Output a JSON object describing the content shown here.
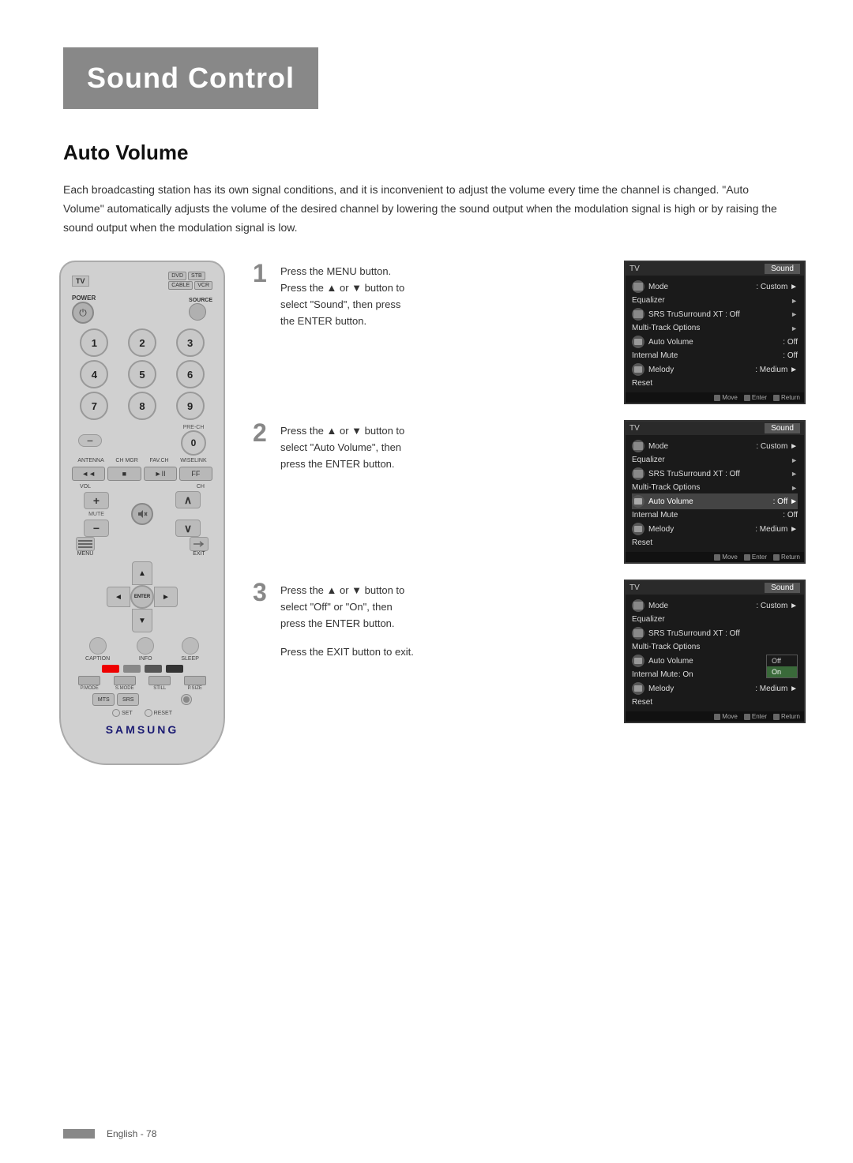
{
  "page": {
    "title": "Sound Control",
    "section": "Auto Volume",
    "description": "Each broadcasting station has its own signal conditions, and it is inconvenient to adjust the volume every time the channel is changed. \"Auto Volume\" automatically adjusts the volume of the desired channel by lowering the sound output when the modulation signal is high or by raising the sound output when the modulation signal is low.",
    "footer_text": "English - 78"
  },
  "steps": [
    {
      "number": "1",
      "instruction": "Press the MENU button.\nPress the ▲ or ▼ button to select \"Sound\", then press\nthe ENTER button."
    },
    {
      "number": "2",
      "instruction": "Press the ▲ or ▼ button to\nselect \"Auto Volume\", then\npress the ENTER button."
    },
    {
      "number": "3",
      "instruction": "Press the ▲ or ▼ button to\nselect \"Off\" or \"On\", then\npress the ENTER button.",
      "extra": "Press the EXIT button to exit."
    }
  ],
  "tv_screens": [
    {
      "header_left": "TV",
      "header_right": "Sound",
      "menu_items": [
        {
          "icon": "input",
          "label": "Mode",
          "value": ": Custom",
          "arrow": "►",
          "highlighted": false
        },
        {
          "icon": "",
          "label": "Equalizer",
          "value": "",
          "arrow": "►",
          "highlighted": false
        },
        {
          "icon": "picture",
          "label": "SRS TruSurround XT : Off",
          "value": "",
          "arrow": "►",
          "highlighted": false
        },
        {
          "icon": "",
          "label": "Multi-Track Options",
          "value": "",
          "arrow": "►",
          "highlighted": false
        },
        {
          "icon": "sound",
          "label": "Auto Volume",
          "value": ": Off",
          "arrow": "",
          "highlighted": false
        },
        {
          "icon": "",
          "label": "Internal Mute",
          "value": ": Off",
          "arrow": "",
          "highlighted": false
        },
        {
          "icon": "channel",
          "label": "Melody",
          "value": ": Medium",
          "arrow": "►",
          "highlighted": false
        },
        {
          "icon": "",
          "label": "Reset",
          "value": "",
          "arrow": "",
          "highlighted": false
        }
      ]
    },
    {
      "header_left": "TV",
      "header_right": "Sound",
      "menu_items": [
        {
          "icon": "input",
          "label": "Mode",
          "value": ": Custom",
          "arrow": "►",
          "highlighted": false
        },
        {
          "icon": "",
          "label": "Equalizer",
          "value": "",
          "arrow": "►",
          "highlighted": false
        },
        {
          "icon": "picture",
          "label": "SRS TruSurround XT : Off",
          "value": "",
          "arrow": "►",
          "highlighted": false
        },
        {
          "icon": "",
          "label": "Multi-Track Options",
          "value": "",
          "arrow": "►",
          "highlighted": false
        },
        {
          "icon": "sound",
          "label": "Auto Volume",
          "value": ": Off",
          "arrow": "►",
          "highlighted": true
        },
        {
          "icon": "",
          "label": "Internal Mute",
          "value": ": Off",
          "arrow": "",
          "highlighted": false
        },
        {
          "icon": "channel",
          "label": "Melody",
          "value": ": Medium",
          "arrow": "►",
          "highlighted": false
        },
        {
          "icon": "",
          "label": "Reset",
          "value": "",
          "arrow": "",
          "highlighted": false
        }
      ]
    },
    {
      "header_left": "TV",
      "header_right": "Sound",
      "menu_items": [
        {
          "icon": "input",
          "label": "Mode",
          "value": ": Custom",
          "arrow": "►",
          "highlighted": false
        },
        {
          "icon": "",
          "label": "Equalizer",
          "value": "",
          "arrow": "►",
          "highlighted": false
        },
        {
          "icon": "picture",
          "label": "SRS TruSurround XT : Off",
          "value": "",
          "arrow": "►",
          "highlighted": false
        },
        {
          "icon": "",
          "label": "Multi-Track Options",
          "value": "",
          "arrow": "►",
          "highlighted": false
        },
        {
          "icon": "sound",
          "label": "Auto Volume",
          "value": "",
          "arrow": "",
          "highlighted": false
        },
        {
          "icon": "",
          "label": "Internal Mute",
          "value": ": On",
          "arrow": "",
          "highlighted": false
        },
        {
          "icon": "channel",
          "label": "Melody",
          "value": ": Medium",
          "arrow": "►",
          "highlighted": false
        },
        {
          "icon": "",
          "label": "Reset",
          "value": "",
          "arrow": "",
          "highlighted": false
        }
      ],
      "dropdown": [
        "Off",
        "On"
      ],
      "dropdown_selected": "On"
    }
  ],
  "remote": {
    "tv_label": "TV",
    "dvd_label": "DVD",
    "stb_label": "STB",
    "cable_label": "CABLE",
    "vcr_label": "VCR",
    "power_label": "POWER",
    "source_label": "SOURCE",
    "numbers": [
      "1",
      "2",
      "3",
      "4",
      "5",
      "6",
      "7",
      "8",
      "9",
      "-",
      "0"
    ],
    "pre_ch": "PRE-CH",
    "antenna_labels": [
      "ANTENNA",
      "CH MGR",
      "FAV.CH",
      "WISELINK"
    ],
    "transport": [
      "◄◄",
      "■",
      "►II",
      "FF"
    ],
    "vol_label": "VOL",
    "ch_label": "CH",
    "mute_label": "MUTE",
    "menu_label": "MENU",
    "exit_label": "EXIT",
    "enter_label": "ENTER",
    "caption_label": "CAPTION",
    "info_label": "INFO",
    "sleep_label": "SLEEP",
    "p_mode": "P.MODE",
    "s_mode": "S.MODE",
    "still_label": "STILL",
    "p_size": "P.SIZE",
    "mts_label": "MTS",
    "srs_label": "SRS",
    "set_label": "SET",
    "reset_label": "RESET",
    "samsung_label": "SAMSUNG"
  }
}
